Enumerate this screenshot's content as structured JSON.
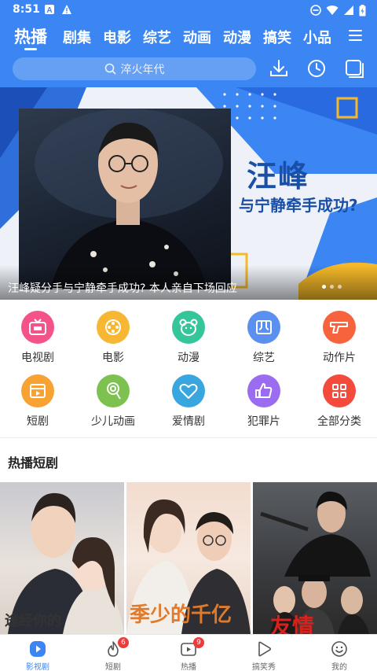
{
  "status_bar": {
    "time": "8:51"
  },
  "tabs": [
    {
      "label": "热播",
      "active": true
    },
    {
      "label": "剧集"
    },
    {
      "label": "电影"
    },
    {
      "label": "综艺"
    },
    {
      "label": "动画"
    },
    {
      "label": "动漫"
    },
    {
      "label": "搞笑"
    },
    {
      "label": "小品"
    }
  ],
  "search": {
    "placeholder": "淬火年代"
  },
  "banner": {
    "title_line1": "汪峰",
    "title_line2": "与宁静牵手成功?",
    "caption": "汪峰疑分手与宁静牵手成功? 本人亲自下场回应",
    "slide_count": 3,
    "active_slide": 1
  },
  "categories": [
    {
      "label": "电视剧",
      "icon": "tv-icon",
      "color": "#f4538a"
    },
    {
      "label": "电影",
      "icon": "film-reel-icon",
      "color": "#f7b733"
    },
    {
      "label": "动漫",
      "icon": "bear-icon",
      "color": "#35c59a"
    },
    {
      "label": "综艺",
      "icon": "variety-icon",
      "color": "#5b8ff0"
    },
    {
      "label": "动作片",
      "icon": "gun-icon",
      "color": "#f7633c"
    },
    {
      "label": "短剧",
      "icon": "clapper-icon",
      "color": "#f7a233"
    },
    {
      "label": "少儿动画",
      "icon": "lollipop-icon",
      "color": "#7dc251"
    },
    {
      "label": "爱情剧",
      "icon": "heart-icon",
      "color": "#3aa6e0"
    },
    {
      "label": "犯罪片",
      "icon": "thumbs-up-icon",
      "color": "#9b6cf0"
    },
    {
      "label": "全部分类",
      "icon": "grid-icon",
      "color": "#f44a3c"
    }
  ],
  "section": {
    "title": "热播短剧"
  },
  "posters": [
    {
      "text": "途经你的"
    },
    {
      "text": "季少的千亿"
    },
    {
      "text": "友情"
    }
  ],
  "bottom_nav": [
    {
      "label": "影视剧",
      "icon": "play-circle-icon",
      "active": true
    },
    {
      "label": "短剧",
      "icon": "flame-icon",
      "badge": "6"
    },
    {
      "label": "热播",
      "icon": "tv-play-icon",
      "badge": "9"
    },
    {
      "label": "搞笑秀",
      "icon": "play-outline-icon"
    },
    {
      "label": "我的",
      "icon": "smile-icon"
    }
  ],
  "colors": {
    "primary": "#3b86f2",
    "badge": "#f03a3a"
  }
}
